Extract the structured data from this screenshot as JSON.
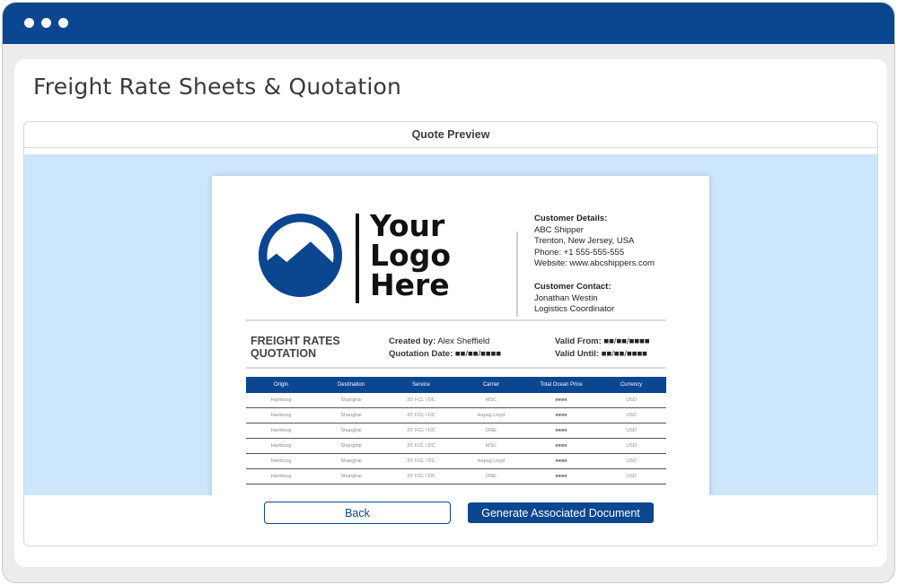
{
  "page": {
    "title": "Freight Rate Sheets & Quotation"
  },
  "panel": {
    "heading": "Quote Preview"
  },
  "colors": {
    "brand": "#0b4690",
    "preview_bg": "#cce6fb"
  },
  "quote": {
    "logo": {
      "line1": "Your",
      "line2": "Logo",
      "line3": "Here",
      "icon": "mountain-circle-icon"
    },
    "customer": {
      "details_label": "Customer Details:",
      "name": "ABC Shipper",
      "address": "Trenton, New Jersey, USA",
      "phone": "Phone: +1 555-555-555",
      "website": "Website: www.abcshippers.com",
      "contact_label": "Customer Contact:",
      "contact_name": "Jonathan Westin",
      "contact_role": "Logistics Coordinator"
    },
    "title_line1": "FREIGHT RATES",
    "title_line2": "QUOTATION",
    "created_by_label": "Created by:",
    "created_by": "Alex Sheffield",
    "quotation_date_label": "Quotation Date:",
    "quotation_date": "■■/■■/■■■■",
    "valid_from_label": "Valid From:",
    "valid_from": "■■/■■/■■■■",
    "valid_until_label": "Valid Until:",
    "valid_until": "■■/■■/■■■■",
    "table": {
      "columns": [
        "Origin",
        "Destination",
        "Service",
        "Carrier",
        "Total Ocean Price",
        "Currency"
      ],
      "rows": [
        [
          "Hamburg",
          "Shanghai",
          "20' FCL / DC",
          "MSC",
          "■■■■",
          "USD"
        ],
        [
          "Hamburg",
          "Shanghai",
          "20' FCL / DC",
          "Hapag Lloyd",
          "■■■■",
          "USD"
        ],
        [
          "Hamburg",
          "Shanghai",
          "20' FCL / DC",
          "ONE",
          "■■■■",
          "USD"
        ],
        [
          "Hamburg",
          "Shanghai",
          "20' FCL / DC",
          "MSC",
          "■■■■",
          "USD"
        ],
        [
          "Hamburg",
          "Shanghai",
          "20' FCL / DC",
          "Hapag Lloyd",
          "■■■■",
          "USD"
        ],
        [
          "Hamburg",
          "Shanghai",
          "20' FCL / DC",
          "ONE",
          "■■■■",
          "USD"
        ]
      ]
    }
  },
  "actions": {
    "back_label": "Back",
    "generate_label": "Generate Associated Document"
  }
}
